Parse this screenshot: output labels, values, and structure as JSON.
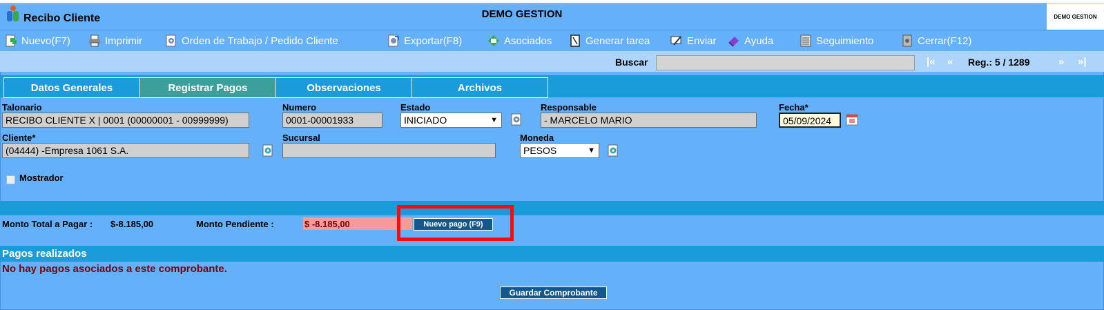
{
  "header": {
    "app_title": "Recibo Cliente",
    "company": "DEMO GESTION",
    "brand_box": "DEMO GESTION"
  },
  "toolbar": {
    "items": [
      {
        "label": "Nuevo(F7)",
        "icon": "new-icon"
      },
      {
        "label": "Imprimir",
        "icon": "printer-icon"
      },
      {
        "label": "Orden de Trabajo / Pedido Cliente",
        "icon": "gear-icon"
      },
      {
        "label": "Exportar(F8)",
        "icon": "export-icon"
      },
      {
        "label": "Asociados",
        "icon": "associated-icon"
      },
      {
        "label": "Generar tarea",
        "icon": "task-icon"
      },
      {
        "label": "Enviar",
        "icon": "send-icon"
      },
      {
        "label": "Ayuda",
        "icon": "help-icon"
      },
      {
        "label": "Seguimiento",
        "icon": "tracking-icon"
      },
      {
        "label": "Cerrar(F12)",
        "icon": "close-icon"
      }
    ]
  },
  "search": {
    "label": "Buscar",
    "value": "",
    "nav_first": "|«",
    "nav_prev": "«",
    "record_label": "Reg.: 5 / 1289",
    "nav_next": "»",
    "nav_last": "»|"
  },
  "tabs": [
    {
      "label": "Datos Generales",
      "active": false
    },
    {
      "label": "Registrar Pagos",
      "active": true
    },
    {
      "label": "Observaciones",
      "active": false
    },
    {
      "label": "Archivos",
      "active": false
    }
  ],
  "form": {
    "talonario": {
      "label": "Talonario",
      "value": "RECIBO CLIENTE X | 0001 (00000001 - 00999999)"
    },
    "numero": {
      "label": "Numero",
      "value": "0001-00001933"
    },
    "estado": {
      "label": "Estado",
      "value": "INICIADO"
    },
    "responsable": {
      "label": "Responsable",
      "value": "- MARCELO MARIO"
    },
    "fecha": {
      "label": "Fecha*",
      "value": "05/09/2024"
    },
    "cliente": {
      "label": "Cliente*",
      "value": "(04444) -Empresa 1061 S.A."
    },
    "sucursal": {
      "label": "Sucursal",
      "value": ""
    },
    "moneda": {
      "label": "Moneda",
      "value": "PESOS"
    },
    "mostrador": {
      "label": "Mostrador",
      "checked": false
    }
  },
  "montos": {
    "total_label": "Monto Total a Pagar :",
    "total_value": "$-8.185,00",
    "pendiente_label": "Monto Pendiente :",
    "pendiente_value": "$ -8.185,00",
    "nuevo_pago_button": "Nuevo pago (F9)"
  },
  "pagos": {
    "title": "Pagos realizados",
    "empty_message": "No hay pagos asociados a este comprobante."
  },
  "footer": {
    "save_button": "Guardar Comprobante"
  },
  "colors": {
    "panel_blue": "#64b0fa",
    "band_blue": "#199cd9",
    "active_tab": "#3d9f9c",
    "button_navy": "#12588e",
    "pending_red": "#f89a9a",
    "highlight": "#ff0a0a",
    "empty_message": "#7a0000"
  }
}
